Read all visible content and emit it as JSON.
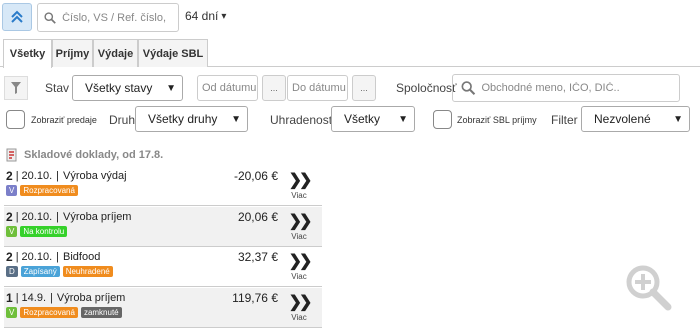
{
  "top": {
    "search_placeholder": "Číslo, VS / Ref. číslo,",
    "days": "64 dní",
    "days_caret": "▾"
  },
  "tabs": [
    {
      "label": "Všetky",
      "active": true
    },
    {
      "label": "Príjmy"
    },
    {
      "label": "Výdaje"
    },
    {
      "label": "Výdaje SBL"
    }
  ],
  "filters": {
    "stav_label": "Stav",
    "stav_value": "Všetky stavy",
    "from_placeholder": "Od dátumu",
    "to_placeholder": "Do dátumu",
    "dots": "...",
    "company_label": "Spoločnosť",
    "company_placeholder": "Obchodné meno, IČO, DIČ..",
    "show_sales_label": "Zobraziť predaje",
    "druh_label": "Druh",
    "druh_value": "Všetky druhy",
    "uhradenost_label": "Uhradenosť",
    "uhradenost_value": "Všetky",
    "show_sbl_label": "Zobraziť SBL príjmy",
    "filter_label": "Filter",
    "filter_value": "Nezvolené"
  },
  "list": {
    "heading": "Skladové doklady, od 17.8.",
    "more_label": "Viac",
    "more_arrows": "❯❯",
    "items": [
      {
        "count": "2",
        "date": "20.10.",
        "name": "Výroba výdaj",
        "amount": "-20,06 €",
        "badges": [
          {
            "text": "V",
            "color": "#7b7fc9"
          },
          {
            "text": "Rozpracovaná",
            "color": "#f08c1e"
          }
        ]
      },
      {
        "count": "2",
        "date": "20.10.",
        "name": "Výroba príjem",
        "amount": "20,06 €",
        "badges": [
          {
            "text": "V",
            "color": "#6fbf3b"
          },
          {
            "text": "Na kontrolu",
            "color": "#35d12a"
          }
        ]
      },
      {
        "count": "2",
        "date": "20.10.",
        "name": "Bidfood",
        "amount": "32,37 €",
        "badges": [
          {
            "text": "D",
            "color": "#5a6f86"
          },
          {
            "text": "Zapísaný",
            "color": "#4aa3d8"
          },
          {
            "text": "Neuhradené",
            "color": "#f08c1e"
          }
        ]
      },
      {
        "count": "1",
        "date": "14.9.",
        "name": "Výroba príjem",
        "amount": "119,76 €",
        "badges": [
          {
            "text": "V",
            "color": "#6fbf3b"
          },
          {
            "text": "Rozpracovaná",
            "color": "#f08c1e"
          },
          {
            "text": "zamknuté",
            "color": "#666666"
          }
        ]
      }
    ]
  },
  "colors": {
    "accent": "#2a7bc9",
    "caret": "#222"
  }
}
